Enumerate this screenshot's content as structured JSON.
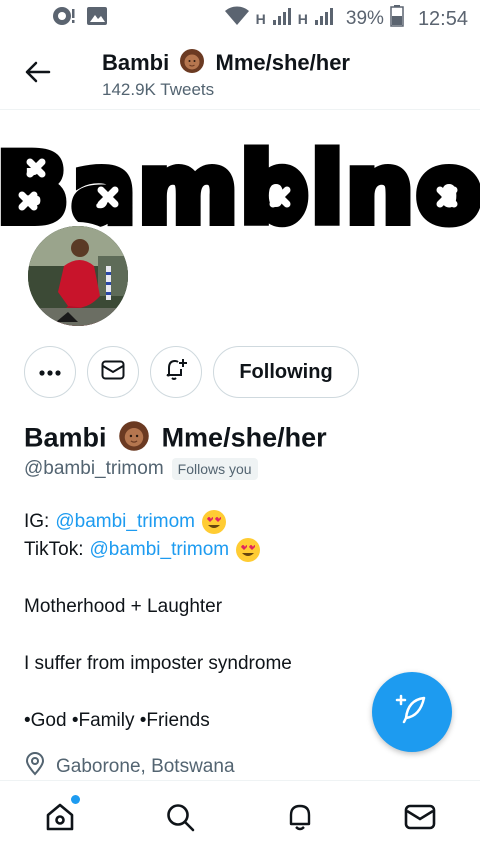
{
  "status_bar": {
    "time": "12:54",
    "battery": "39%",
    "network_1": "H",
    "network_2": "H"
  },
  "header": {
    "title_name": "Bambi",
    "title_pronouns": "Mme/she/her",
    "tweet_count": "142.9K Tweets"
  },
  "banner": {
    "text": "Bambino"
  },
  "actions": {
    "following_label": "Following"
  },
  "profile": {
    "name": "Bambi",
    "pronouns": "Mme/she/her",
    "handle": "@bambi_trimom",
    "follows_you": "Follows you",
    "location": "Gaborone, Botswana"
  },
  "bio": {
    "ig_prefix": "IG:",
    "ig_link": "@bambi_trimom",
    "tiktok_prefix": "TikTok:",
    "tiktok_link": "@bambi_trimom",
    "line_motherhood": "Motherhood + Laughter",
    "line_imposter": "I suffer from imposter syndrome",
    "line_values": "•God •Family •Friends"
  },
  "colors": {
    "accent": "#1d9bf0",
    "text": "#0f1419",
    "muted": "#536471"
  },
  "icons": {
    "back": "arrow-left-icon",
    "more": "more-dots-icon",
    "message": "envelope-icon",
    "notify": "bell-plus-icon",
    "compose": "feather-plus-icon",
    "home": "home-icon",
    "search": "search-icon",
    "notifications": "bell-icon",
    "messages": "envelope-icon",
    "location": "location-pin-icon"
  }
}
